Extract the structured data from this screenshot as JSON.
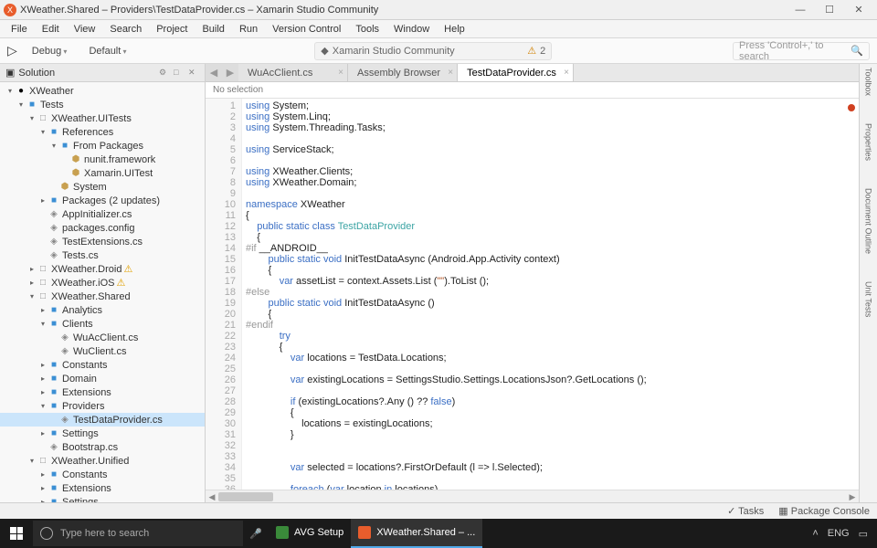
{
  "window": {
    "title": "XWeather.Shared – Providers\\TestDataProvider.cs – Xamarin Studio Community",
    "min": "—",
    "max": "☐",
    "close": "✕"
  },
  "menu": [
    "File",
    "Edit",
    "View",
    "Search",
    "Project",
    "Build",
    "Run",
    "Version Control",
    "Tools",
    "Window",
    "Help"
  ],
  "toolbar": {
    "play": "▷",
    "config": "Debug",
    "target": "Default",
    "status_app": "Xamarin Studio Community",
    "status_icon": "⚠",
    "status_count": "2",
    "search_placeholder": "Press 'Control+,' to search",
    "search_icon": "🔍"
  },
  "sidebar": {
    "title": "Solution",
    "icons": {
      "cfg": "⚙",
      "pin": "□",
      "x": "✕"
    }
  },
  "tree": [
    {
      "d": 0,
      "tw": "▾",
      "ic": "●",
      "cls": "",
      "lbl": "XWeather"
    },
    {
      "d": 1,
      "tw": "▾",
      "ic": "■",
      "cls": "folder",
      "lbl": "Tests"
    },
    {
      "d": 2,
      "tw": "▾",
      "ic": "□",
      "cls": "file",
      "lbl": "XWeather.UITests"
    },
    {
      "d": 3,
      "tw": "▾",
      "ic": "■",
      "cls": "folder",
      "lbl": "References"
    },
    {
      "d": 4,
      "tw": "▾",
      "ic": "■",
      "cls": "folder",
      "lbl": "From Packages"
    },
    {
      "d": 5,
      "tw": "",
      "ic": "⬢",
      "cls": "pkg",
      "lbl": "nunit.framework"
    },
    {
      "d": 5,
      "tw": "",
      "ic": "⬢",
      "cls": "pkg",
      "lbl": "Xamarin.UITest"
    },
    {
      "d": 4,
      "tw": "",
      "ic": "⬢",
      "cls": "pkg",
      "lbl": "System"
    },
    {
      "d": 3,
      "tw": "▸",
      "ic": "■",
      "cls": "folder",
      "lbl": "Packages (2 updates)"
    },
    {
      "d": 3,
      "tw": "",
      "ic": "◈",
      "cls": "file",
      "lbl": "AppInitializer.cs"
    },
    {
      "d": 3,
      "tw": "",
      "ic": "◈",
      "cls": "file",
      "lbl": "packages.config"
    },
    {
      "d": 3,
      "tw": "",
      "ic": "◈",
      "cls": "file",
      "lbl": "TestExtensions.cs"
    },
    {
      "d": 3,
      "tw": "",
      "ic": "◈",
      "cls": "file",
      "lbl": "Tests.cs"
    },
    {
      "d": 2,
      "tw": "▸",
      "ic": "□",
      "cls": "file",
      "lbl": "XWeather.Droid",
      "warn": "⚠"
    },
    {
      "d": 2,
      "tw": "▸",
      "ic": "□",
      "cls": "file",
      "lbl": "XWeather.iOS",
      "warn": "⚠"
    },
    {
      "d": 2,
      "tw": "▾",
      "ic": "□",
      "cls": "file",
      "lbl": "XWeather.Shared"
    },
    {
      "d": 3,
      "tw": "▸",
      "ic": "■",
      "cls": "folder",
      "lbl": "Analytics"
    },
    {
      "d": 3,
      "tw": "▾",
      "ic": "■",
      "cls": "folder",
      "lbl": "Clients"
    },
    {
      "d": 4,
      "tw": "",
      "ic": "◈",
      "cls": "file",
      "lbl": "WuAcClient.cs"
    },
    {
      "d": 4,
      "tw": "",
      "ic": "◈",
      "cls": "file",
      "lbl": "WuClient.cs"
    },
    {
      "d": 3,
      "tw": "▸",
      "ic": "■",
      "cls": "folder",
      "lbl": "Constants"
    },
    {
      "d": 3,
      "tw": "▸",
      "ic": "■",
      "cls": "folder",
      "lbl": "Domain"
    },
    {
      "d": 3,
      "tw": "▸",
      "ic": "■",
      "cls": "folder",
      "lbl": "Extensions"
    },
    {
      "d": 3,
      "tw": "▾",
      "ic": "■",
      "cls": "folder",
      "lbl": "Providers"
    },
    {
      "d": 4,
      "tw": "",
      "ic": "◈",
      "cls": "file",
      "lbl": "TestDataProvider.cs",
      "sel": true
    },
    {
      "d": 3,
      "tw": "▸",
      "ic": "■",
      "cls": "folder",
      "lbl": "Settings"
    },
    {
      "d": 3,
      "tw": "",
      "ic": "◈",
      "cls": "file",
      "lbl": "Bootstrap.cs"
    },
    {
      "d": 2,
      "tw": "▾",
      "ic": "□",
      "cls": "file",
      "lbl": "XWeather.Unified"
    },
    {
      "d": 3,
      "tw": "▸",
      "ic": "■",
      "cls": "folder",
      "lbl": "Constants"
    },
    {
      "d": 3,
      "tw": "▸",
      "ic": "■",
      "cls": "folder",
      "lbl": "Extensions"
    },
    {
      "d": 3,
      "tw": "▸",
      "ic": "■",
      "cls": "folder",
      "lbl": "Settings"
    }
  ],
  "tabs": {
    "nav_back": "◀",
    "nav_fwd": "▶",
    "items": [
      {
        "label": "WuAcClient.cs",
        "active": false
      },
      {
        "label": "Assembly Browser",
        "active": false
      },
      {
        "label": "TestDataProvider.cs",
        "active": true
      }
    ],
    "close": "×"
  },
  "breadcrumb": "No selection",
  "code_lines": [
    {
      "n": 1,
      "seg": [
        [
          "kw",
          "using"
        ],
        [
          "",
          " System;"
        ]
      ]
    },
    {
      "n": 2,
      "seg": [
        [
          "kw",
          "using"
        ],
        [
          "",
          " System.Linq;"
        ]
      ]
    },
    {
      "n": 3,
      "seg": [
        [
          "kw",
          "using"
        ],
        [
          "",
          " System.Threading.Tasks;"
        ]
      ]
    },
    {
      "n": 4,
      "seg": []
    },
    {
      "n": 5,
      "seg": [
        [
          "kw",
          "using"
        ],
        [
          "",
          " ServiceStack;"
        ]
      ]
    },
    {
      "n": 6,
      "seg": []
    },
    {
      "n": 7,
      "seg": [
        [
          "kw",
          "using"
        ],
        [
          "",
          " XWeather.Clients;"
        ]
      ]
    },
    {
      "n": 8,
      "seg": [
        [
          "kw",
          "using"
        ],
        [
          "",
          " XWeather.Domain;"
        ]
      ]
    },
    {
      "n": 9,
      "seg": []
    },
    {
      "n": 10,
      "seg": [
        [
          "kw",
          "namespace"
        ],
        [
          "",
          " XWeather"
        ]
      ]
    },
    {
      "n": 11,
      "seg": [
        [
          "",
          "{"
        ]
      ]
    },
    {
      "n": 12,
      "seg": [
        [
          "",
          "    "
        ],
        [
          "kw",
          "public static class"
        ],
        [
          "",
          " "
        ],
        [
          "type",
          "TestDataProvider"
        ]
      ]
    },
    {
      "n": 13,
      "seg": [
        [
          "",
          "    {"
        ]
      ]
    },
    {
      "n": 14,
      "seg": [
        [
          "pre",
          "#if"
        ],
        [
          "",
          " __ANDROID__"
        ]
      ]
    },
    {
      "n": 15,
      "seg": [
        [
          "",
          "        "
        ],
        [
          "kw",
          "public static void"
        ],
        [
          "",
          " InitTestDataAsync (Android.App.Activity context)"
        ]
      ]
    },
    {
      "n": 16,
      "seg": [
        [
          "",
          "        {"
        ]
      ]
    },
    {
      "n": 17,
      "seg": [
        [
          "",
          "            "
        ],
        [
          "kw",
          "var"
        ],
        [
          "",
          " assetList = context.Assets.List ("
        ],
        [
          "str",
          "\"\""
        ],
        [
          "",
          ").ToList ();"
        ]
      ]
    },
    {
      "n": 18,
      "seg": [
        [
          "pre",
          "#else"
        ]
      ]
    },
    {
      "n": 19,
      "seg": [
        [
          "",
          "        "
        ],
        [
          "kw",
          "public static void"
        ],
        [
          "",
          " InitTestDataAsync ()"
        ]
      ]
    },
    {
      "n": 20,
      "seg": [
        [
          "",
          "        {"
        ]
      ]
    },
    {
      "n": 21,
      "seg": [
        [
          "pre",
          "#endif"
        ]
      ]
    },
    {
      "n": 22,
      "seg": [
        [
          "",
          "            "
        ],
        [
          "kw",
          "try"
        ]
      ]
    },
    {
      "n": 23,
      "seg": [
        [
          "",
          "            {"
        ]
      ]
    },
    {
      "n": 24,
      "seg": [
        [
          "",
          "                "
        ],
        [
          "kw",
          "var"
        ],
        [
          "",
          " locations = TestData.Locations;"
        ]
      ]
    },
    {
      "n": 25,
      "seg": []
    },
    {
      "n": 26,
      "seg": [
        [
          "",
          "                "
        ],
        [
          "kw",
          "var"
        ],
        [
          "",
          " existingLocations = SettingsStudio.Settings.LocationsJson?.GetLocations ();"
        ]
      ]
    },
    {
      "n": 27,
      "seg": []
    },
    {
      "n": 28,
      "seg": [
        [
          "",
          "                "
        ],
        [
          "kw",
          "if"
        ],
        [
          "",
          " (existingLocations?.Any () ?? "
        ],
        [
          "kw",
          "false"
        ],
        [
          "",
          ")"
        ]
      ]
    },
    {
      "n": 29,
      "seg": [
        [
          "",
          "                {"
        ]
      ]
    },
    {
      "n": 30,
      "seg": [
        [
          "",
          "                    locations = existingLocations;"
        ]
      ]
    },
    {
      "n": 31,
      "seg": [
        [
          "",
          "                }"
        ]
      ]
    },
    {
      "n": 32,
      "seg": []
    },
    {
      "n": 33,
      "seg": []
    },
    {
      "n": 34,
      "seg": [
        [
          "",
          "                "
        ],
        [
          "kw",
          "var"
        ],
        [
          "",
          " selected = locations?.FirstOrDefault (l => l.Selected);"
        ]
      ]
    },
    {
      "n": 35,
      "seg": []
    },
    {
      "n": 36,
      "seg": [
        [
          "",
          "                "
        ],
        [
          "kw",
          "foreach"
        ],
        [
          "",
          " ("
        ],
        [
          "kw",
          "var"
        ],
        [
          "",
          " location "
        ],
        [
          "kw",
          "in"
        ],
        [
          "",
          " locations)"
        ]
      ]
    }
  ],
  "rightbar": [
    "Toolbox",
    "Properties",
    "Document Outline",
    "Unit Tests"
  ],
  "statusbar": {
    "tasks_icon": "✓",
    "tasks": "Tasks",
    "pkg_icon": "▦",
    "pkg": "Package Console"
  },
  "taskbar": {
    "search_placeholder": "Type here to search",
    "mic": "🎤",
    "tasks": [
      {
        "label": "AVG Setup",
        "color": "#3a8a3a",
        "active": false
      },
      {
        "label": "XWeather.Shared – ...",
        "color": "#e85d2c",
        "active": true
      }
    ],
    "tray_up": "˄",
    "tray_lang": "ENG",
    "tray_notif": "▭"
  }
}
